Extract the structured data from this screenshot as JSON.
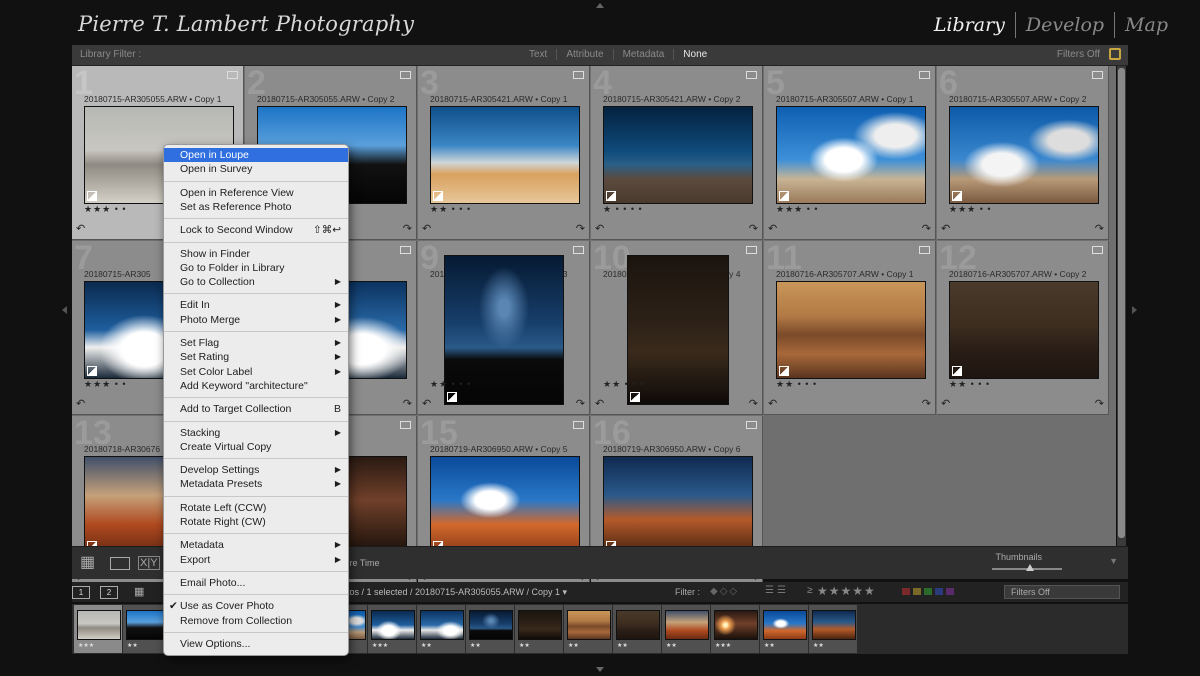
{
  "identity_plate": "Pierre T. Lambert Photography",
  "modules": [
    "Library",
    "Develop",
    "Map"
  ],
  "active_module": "Library",
  "filter_bar": {
    "label": "Library Filter :",
    "tabs": [
      "Text",
      "Attribute",
      "Metadata",
      "None"
    ],
    "selected_tab": "None",
    "filters_off": "Filters Off"
  },
  "grid": {
    "cells": [
      {
        "num": "1",
        "name": "20180715-AR305055.ARW • Copy 1",
        "stars": "★★★ • •",
        "selected": true
      },
      {
        "num": "2",
        "name": "20180715-AR305055.ARW • Copy 2",
        "stars": "",
        "selected": false
      },
      {
        "num": "3",
        "name": "20180715-AR305421.ARW • Copy 1",
        "stars": "★★ • • •",
        "selected": false
      },
      {
        "num": "4",
        "name": "20180715-AR305421.ARW • Copy 2",
        "stars": "★ • • • •",
        "selected": false
      },
      {
        "num": "5",
        "name": "20180715-AR305507.ARW • Copy 1",
        "stars": "★★★ • •",
        "selected": false
      },
      {
        "num": "6",
        "name": "20180715-AR305507.ARW • Copy 2",
        "stars": "★★★ • •",
        "selected": false
      },
      {
        "num": "7",
        "name": "20180715-AR305",
        "stars": "★★★ • •",
        "selected": false
      },
      {
        "num": "8",
        "name": "• Copy 2",
        "stars": "",
        "selected": false
      },
      {
        "num": "9",
        "name": "20180716-AR305558.ARW • Copy 3",
        "stars": "★★ • • •",
        "selected": false
      },
      {
        "num": "10",
        "name": "20180716-AR305558.ARW • Copy 4",
        "stars": "★★ • • •",
        "selected": false
      },
      {
        "num": "11",
        "name": "20180716-AR305707.ARW • Copy 1",
        "stars": "★★ • • •",
        "selected": false
      },
      {
        "num": "12",
        "name": "20180716-AR305707.ARW • Copy 2",
        "stars": "★★ • • •",
        "selected": false
      },
      {
        "num": "13",
        "name": "20180718-AR30676",
        "stars": "",
        "selected": false
      },
      {
        "num": "14",
        "name": "• Copy 2",
        "stars": "",
        "selected": false
      },
      {
        "num": "15",
        "name": "20180719-AR306950.ARW • Copy 5",
        "stars": "",
        "selected": false
      },
      {
        "num": "16",
        "name": "20180719-AR306950.ARW • Copy 6",
        "stars": "",
        "selected": false
      }
    ]
  },
  "toolbar": {
    "sort_text": "ture Time",
    "thumbnails_label": "Thumbnails"
  },
  "filmstrip_header": {
    "pages": [
      "1",
      "2"
    ],
    "path": "otos / 1 selected / 20180715-AR305055.ARW / Copy 1 ▾",
    "filter_label": "Filter :",
    "stars_prefix": "≥",
    "stars": "★★★★★",
    "filter_select": "Filters Off"
  },
  "filmstrip": {
    "stars": [
      "★★★",
      "★★",
      "★★★",
      "★★",
      "★★★",
      "★★★",
      "★★★",
      "★★",
      "★★",
      "★★",
      "★★",
      "★★",
      "★★",
      "★★★",
      "★★",
      "★★"
    ]
  },
  "context_menu": {
    "items": [
      {
        "label": "Open in Loupe",
        "highlighted": true
      },
      {
        "label": "Open in Survey"
      },
      {
        "sep": true
      },
      {
        "label": "Open in Reference View"
      },
      {
        "label": "Set as Reference Photo"
      },
      {
        "sep": true
      },
      {
        "label": "Lock to Second Window",
        "shortcut": "⇧⌘↩"
      },
      {
        "sep": true
      },
      {
        "label": "Show in Finder"
      },
      {
        "label": "Go to Folder in Library"
      },
      {
        "label": "Go to Collection",
        "submenu": true
      },
      {
        "sep": true
      },
      {
        "label": "Edit In",
        "submenu": true
      },
      {
        "label": "Photo Merge",
        "submenu": true
      },
      {
        "sep": true
      },
      {
        "label": "Set Flag",
        "submenu": true
      },
      {
        "label": "Set Rating",
        "submenu": true
      },
      {
        "label": "Set Color Label",
        "submenu": true
      },
      {
        "label": "Add Keyword \"architecture\""
      },
      {
        "sep": true
      },
      {
        "label": "Add to Target Collection",
        "shortcut": "B"
      },
      {
        "sep": true
      },
      {
        "label": "Stacking",
        "submenu": true
      },
      {
        "label": "Create Virtual Copy"
      },
      {
        "sep": true
      },
      {
        "label": "Develop Settings",
        "submenu": true
      },
      {
        "label": "Metadata Presets",
        "submenu": true
      },
      {
        "sep": true
      },
      {
        "label": "Rotate Left (CCW)"
      },
      {
        "label": "Rotate Right (CW)"
      },
      {
        "sep": true
      },
      {
        "label": "Metadata",
        "submenu": true
      },
      {
        "label": "Export",
        "submenu": true
      },
      {
        "sep": true
      },
      {
        "label": "Email Photo..."
      },
      {
        "sep": true
      },
      {
        "label": "Use as Cover Photo",
        "checked": true
      },
      {
        "label": "Remove from Collection"
      },
      {
        "sep": true
      },
      {
        "label": "View Options..."
      }
    ]
  }
}
